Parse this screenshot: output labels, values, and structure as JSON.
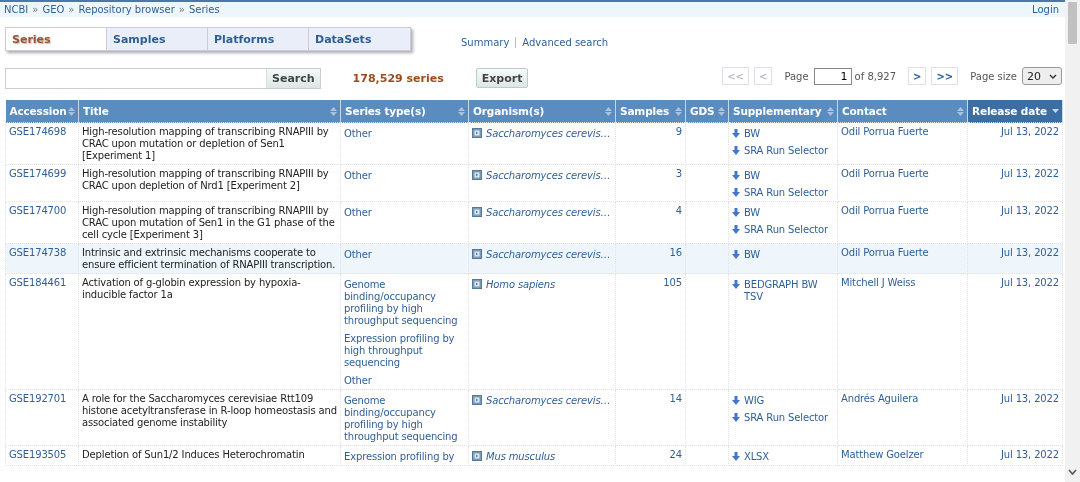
{
  "breadcrumb": [
    {
      "label": "NCBI",
      "separator": "»"
    },
    {
      "label": "GEO",
      "separator": "»"
    },
    {
      "label": "Repository browser",
      "separator": "»"
    },
    {
      "label": "Series"
    }
  ],
  "login": "Login",
  "tabs": [
    {
      "label": "Series",
      "selected": true
    },
    {
      "label": "Samples",
      "selected": false
    },
    {
      "label": "Platforms",
      "selected": false
    },
    {
      "label": "DataSets",
      "selected": false
    }
  ],
  "links": [
    "Summary",
    "Advanced search"
  ],
  "search": {
    "button": "Search"
  },
  "count": "178,529 series",
  "export": "Export",
  "pager": {
    "first": {
      "label": "<<",
      "disabled": true
    },
    "prev": {
      "label": "<",
      "disabled": true
    },
    "page_label": "Page",
    "page": "1",
    "of": "of 8,927",
    "next": {
      "label": ">",
      "disabled": false
    },
    "last": {
      "label": ">>",
      "disabled": false
    },
    "page_size_label": "Page size",
    "page_size": "20"
  },
  "table": {
    "columns": [
      {
        "label": "Accession",
        "sorted": false
      },
      {
        "label": "Title",
        "sorted": false
      },
      {
        "label": "Series type(s)",
        "sorted": false
      },
      {
        "label": "Organism(s)",
        "sorted": false
      },
      {
        "label": "Samples",
        "sorted": false
      },
      {
        "label": "GDS",
        "sorted": false
      },
      {
        "label": "Supplementary",
        "sorted": false
      },
      {
        "label": "Contact",
        "sorted": false
      },
      {
        "label": "Release date",
        "sorted": true
      }
    ],
    "rows": [
      {
        "highlighted": false,
        "accession": "GSE174698",
        "title": "High-resolution mapping of transcribing RNAPIII by CRAC upon mutation or depletion of Sen1 [Experiment 1]",
        "series_types": [
          "Other"
        ],
        "organism": "Saccharomyces cerevis…",
        "samples": "9",
        "supplementary": [
          "BW",
          "SRA Run Selector"
        ],
        "contact": "Odil Porrua Fuerte",
        "release_date": "Jul 13, 2022"
      },
      {
        "highlighted": false,
        "accession": "GSE174699",
        "title": "High-resolution mapping of transcribing RNAPIII by CRAC upon depletion of Nrd1 [Experiment 2]",
        "series_types": [
          "Other"
        ],
        "organism": "Saccharomyces cerevis…",
        "samples": "3",
        "supplementary": [
          "BW",
          "SRA Run Selector"
        ],
        "contact": "Odil Porrua Fuerte",
        "release_date": "Jul 13, 2022"
      },
      {
        "highlighted": false,
        "accession": "GSE174700",
        "title": "High-resolution mapping of transcribing RNAPIII by CRAC upon mutation of Sen1 in the G1 phase of the cell cycle [Experiment 3]",
        "series_types": [
          "Other"
        ],
        "organism": "Saccharomyces cerevis…",
        "samples": "4",
        "supplementary": [
          "BW",
          "SRA Run Selector"
        ],
        "contact": "Odil Porrua Fuerte",
        "release_date": "Jul 13, 2022"
      },
      {
        "highlighted": true,
        "accession": "GSE174738",
        "title": "Intrinsic and extrinsic mechanisms cooperate to ensure efficient termination of RNAPIII transcription.",
        "series_types": [
          "Other"
        ],
        "organism": "Saccharomyces cerevis…",
        "samples": "16",
        "supplementary": [
          "BW"
        ],
        "contact": "Odil Porrua Fuerte",
        "release_date": "Jul 13, 2022"
      },
      {
        "highlighted": false,
        "accession": "GSE184461",
        "title": "Activation of g-globin expression by hypoxia-inducible factor 1a",
        "series_types": [
          "Genome binding/occupancy profiling by high throughput sequencing",
          "Expression profiling by high throughput sequencing",
          "Other"
        ],
        "organism": "Homo sapiens",
        "samples": "105",
        "supplementary": [
          "BEDGRAPH BW TSV"
        ],
        "contact": "Mitchell J Weiss",
        "release_date": "Jul 13, 2022"
      },
      {
        "highlighted": false,
        "accession": "GSE192701",
        "title": "A role for the Saccharomyces cerevisiae Rtt109 histone acetyltransferase in R-loop homeostasis and associated genome instability",
        "series_types": [
          "Genome binding/occupancy profiling by high throughput sequencing"
        ],
        "organism": "Saccharomyces cerevis…",
        "samples": "14",
        "supplementary": [
          "WIG",
          "SRA Run Selector"
        ],
        "contact": "Andrés Aguilera",
        "release_date": "Jul 13, 2022"
      },
      {
        "highlighted": false,
        "accession": "GSE193505",
        "title": "Depletion of Sun1/2 Induces Heterochromatin",
        "series_types": [
          "Expression profiling by"
        ],
        "organism": "Mus musculus",
        "samples": "24",
        "supplementary": [
          "XLSX"
        ],
        "contact": "Matthew Goelzer",
        "release_date": "Jul 13, 2022"
      }
    ]
  }
}
